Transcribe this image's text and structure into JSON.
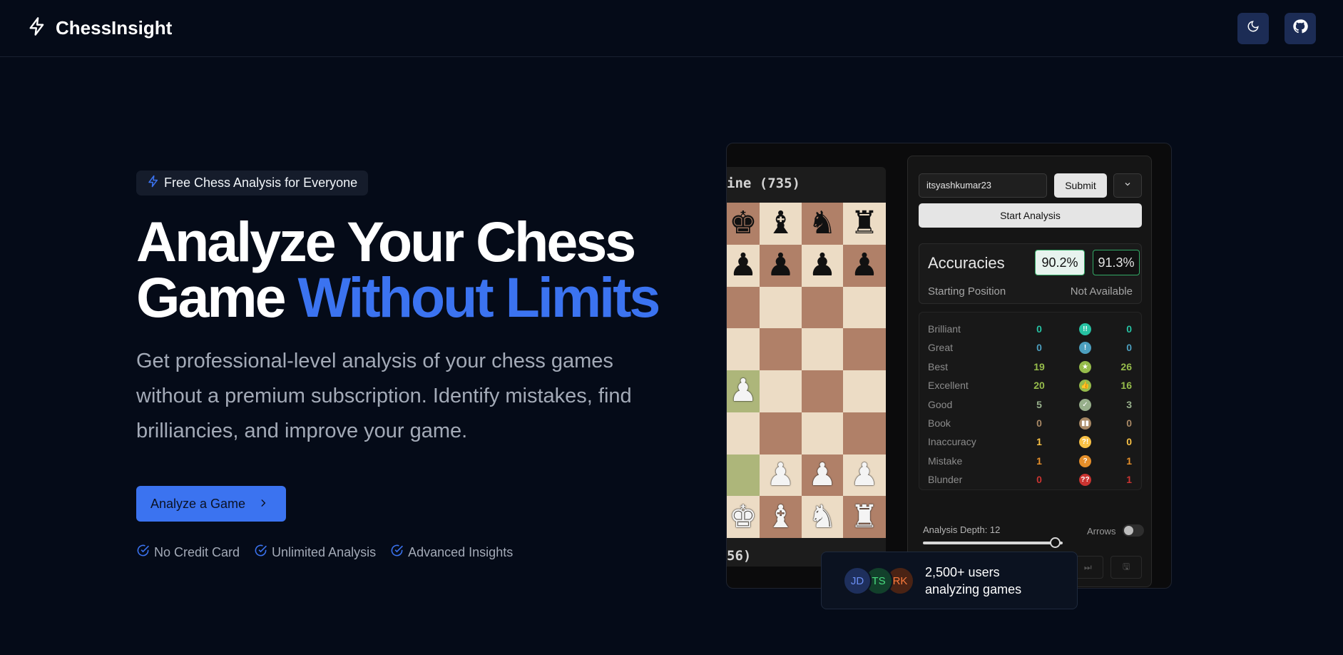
{
  "header": {
    "brand": "ChessInsight",
    "theme_icon": "moon-icon",
    "github_icon": "github-icon"
  },
  "hero": {
    "badge": "Free Chess Analysis for Everyone",
    "headline_line1": "Analyze Your Chess",
    "headline_line2_plain": "Game ",
    "headline_line2_accent": "Without Limits",
    "subtext": "Get professional-level analysis of your chess games without a premium subscription. Identify mistakes, find brilliancies, and improve your game.",
    "cta_label": "Analyze a Game",
    "features": [
      "No Credit Card",
      "Unlimited Analysis",
      "Advanced Insights"
    ]
  },
  "preview": {
    "player_top": "ine (735)",
    "player_bottom": "56)",
    "board_rows": [
      [
        "bk",
        "bb",
        "bn",
        "br"
      ],
      [
        "bp",
        "bp",
        "bp",
        "bp"
      ],
      [
        "",
        "",
        "",
        ""
      ],
      [
        "",
        "",
        "",
        ""
      ],
      [
        "wp",
        "",
        "",
        ""
      ],
      [
        "",
        "",
        "",
        ""
      ],
      [
        "",
        "wp",
        "wp",
        "wp"
      ],
      [
        "wk",
        "wb",
        "wn",
        "wr"
      ]
    ],
    "username": "itsyashkumar23",
    "submit_label": "Submit",
    "start_label": "Start Analysis",
    "accuracies_label": "Accuracies",
    "accuracy_white": "90.2%",
    "accuracy_black": "91.3%",
    "opening_label": "Starting Position",
    "opening_value": "Not Available",
    "classifications": [
      {
        "name": "Brilliant",
        "white": "0",
        "black": "0",
        "color": "#26c2a3",
        "symbol": "!!"
      },
      {
        "name": "Great",
        "white": "0",
        "black": "0",
        "color": "#4c9fbf",
        "symbol": "!"
      },
      {
        "name": "Best",
        "white": "19",
        "black": "26",
        "color": "#96bc4b",
        "symbol": "★"
      },
      {
        "name": "Excellent",
        "white": "20",
        "black": "16",
        "color": "#96bc4b",
        "symbol": "👍"
      },
      {
        "name": "Good",
        "white": "5",
        "black": "3",
        "color": "#97af8b",
        "symbol": "✓"
      },
      {
        "name": "Book",
        "white": "0",
        "black": "0",
        "color": "#a88865",
        "symbol": "▮▮"
      },
      {
        "name": "Inaccuracy",
        "white": "1",
        "black": "0",
        "color": "#f7c045",
        "symbol": "?!"
      },
      {
        "name": "Mistake",
        "white": "1",
        "black": "1",
        "color": "#e58f2a",
        "symbol": "?"
      },
      {
        "name": "Blunder",
        "white": "0",
        "black": "1",
        "color": "#ca3431",
        "symbol": "??"
      }
    ],
    "depth_label": "Analysis Depth: 12",
    "depth_fraction": 0.85,
    "arrows_label": "Arrows"
  },
  "users_card": {
    "avatars": [
      {
        "initials": "JD",
        "bg": "#1e2f5c",
        "fg": "#6b8ff5"
      },
      {
        "initials": "TS",
        "bg": "#12402b",
        "fg": "#4ade80"
      },
      {
        "initials": "RK",
        "bg": "#4a2314",
        "fg": "#fb7a3c"
      }
    ],
    "line1": "2,500+ users",
    "line2": "analyzing games"
  },
  "colors": {
    "background": "#050b18",
    "accent": "#3b73f0"
  }
}
